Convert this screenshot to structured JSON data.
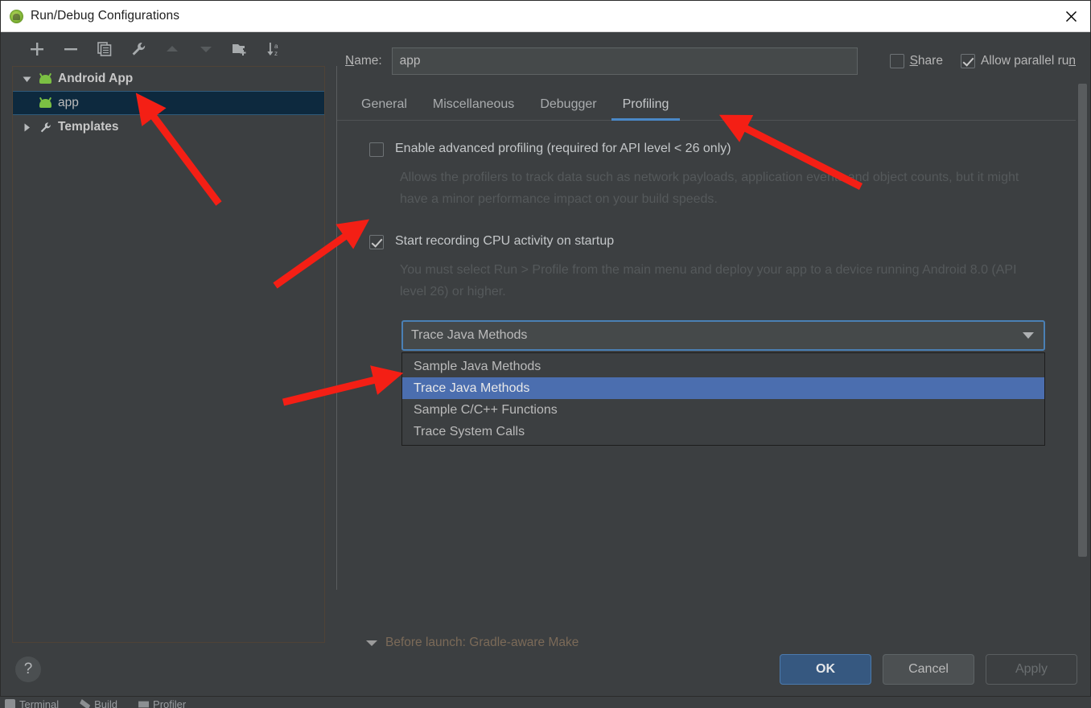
{
  "window": {
    "title": "Run/Debug Configurations",
    "app_icon": "android-studio-icon",
    "close_icon": "close-icon"
  },
  "toolbar": {
    "buttons": [
      {
        "name": "add-configuration-button",
        "icon": "plus-icon",
        "enabled": true
      },
      {
        "name": "remove-configuration-button",
        "icon": "minus-icon",
        "enabled": true
      },
      {
        "name": "copy-configuration-button",
        "icon": "copy-icon",
        "enabled": true
      },
      {
        "name": "edit-templates-button",
        "icon": "wrench-icon",
        "enabled": true
      },
      {
        "name": "move-up-button",
        "icon": "triangle-up-icon",
        "enabled": false
      },
      {
        "name": "move-down-button",
        "icon": "triangle-down-icon",
        "enabled": false
      },
      {
        "name": "create-folder-button",
        "icon": "folder-add-icon",
        "enabled": true
      },
      {
        "name": "sort-configurations-button",
        "icon": "sort-az-icon",
        "enabled": true
      }
    ]
  },
  "tree": {
    "nodes": [
      {
        "label": "Android App",
        "icon": "android-icon",
        "twisty": "expanded",
        "level": 0,
        "selected": false
      },
      {
        "label": "app",
        "icon": "android-icon",
        "twisty": "none",
        "level": 1,
        "selected": true
      },
      {
        "label": "Templates",
        "icon": "wrench-icon",
        "twisty": "collapsed",
        "level": 0,
        "selected": false
      }
    ]
  },
  "name_field": {
    "label": "Name:",
    "label_mnemonic": "N",
    "value": "app",
    "placeholder": ""
  },
  "options": {
    "share": {
      "label": "Share",
      "mnemonic": "S",
      "checked": false
    },
    "allow_parallel_run": {
      "label": "Allow parallel run",
      "mnemonic": "n",
      "checked": true
    }
  },
  "tabs": [
    {
      "label": "General",
      "active": false
    },
    {
      "label": "Miscellaneous",
      "active": false
    },
    {
      "label": "Debugger",
      "active": false
    },
    {
      "label": "Profiling",
      "active": true
    }
  ],
  "profiling": {
    "advanced": {
      "label": "Enable advanced profiling (required for API level < 26 only)",
      "checked": false,
      "description": "Allows the profilers to track data such as network payloads, application events and object counts, but it might have a minor performance impact on your build speeds."
    },
    "cpu_recording": {
      "label": "Start recording CPU activity on startup",
      "checked": true,
      "description": "You must select Run > Profile from the main menu and deploy your app to a device running Android 8.0 (API level 26) or higher."
    },
    "trace_combo": {
      "name": "cpu-recording-configuration-combo",
      "selected": "Trace Java Methods",
      "expanded": true,
      "options": [
        "Sample Java Methods",
        "Trace Java Methods",
        "Sample C/C++ Functions",
        "Trace System Calls"
      ]
    }
  },
  "before_launch": {
    "label": "Before launch: Gradle-aware Make"
  },
  "footer": {
    "help_label": "?",
    "ok_label": "OK",
    "cancel_label": "Cancel",
    "apply_label": "Apply",
    "apply_enabled": false
  },
  "ide_bottom_bar": {
    "items": [
      {
        "label": "Terminal",
        "icon": "terminal-icon"
      },
      {
        "label": "Build",
        "icon": "build-icon"
      },
      {
        "label": "Profiler",
        "icon": "profiler-icon"
      }
    ]
  },
  "colors": {
    "accent_blue": "#4a88c7",
    "selection_blue": "#4b6eaf",
    "tree_selection": "#0d293e",
    "annotation_red": "#f41f15",
    "dialog_bg": "#3c3f41",
    "field_bg": "#45494a",
    "android_green": "#7bc043"
  },
  "annotations": {
    "arrows": [
      {
        "name": "arrow-to-app-node",
        "points": "to app tree item"
      },
      {
        "name": "arrow-to-profiling-tab",
        "points": "to Profiling tab"
      },
      {
        "name": "arrow-to-cpu-checkbox",
        "points": "to Start recording CPU activity checkbox"
      },
      {
        "name": "arrow-to-trace-java-methods",
        "points": "to Trace Java Methods list item"
      }
    ]
  }
}
